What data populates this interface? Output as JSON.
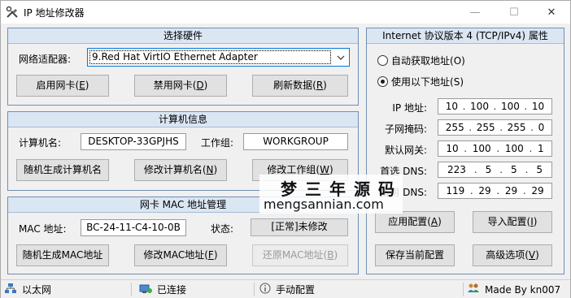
{
  "window": {
    "title": "IP 地址修改器",
    "min_glyph": "—",
    "max_glyph": "☐",
    "close_glyph": "✕"
  },
  "hardware": {
    "header": "选择硬件",
    "adapter_label": "网络适配器:",
    "adapter_value": "9.Red Hat VirtIO Ethernet Adapter",
    "enable_btn": "启用网卡(",
    "enable_key": "E",
    "disable_btn": "禁用网卡(",
    "disable_key": "D",
    "refresh_btn": "刷新数据(",
    "refresh_key": "R"
  },
  "computer": {
    "header": "计算机信息",
    "name_label": "计算机名:",
    "name_value": "DESKTOP-33GPJHS",
    "workgroup_label": "工作组:",
    "workgroup_value": "WORKGROUP",
    "random_name_btn": "随机生成计算机名",
    "modify_name_btn": "修改计算机名(",
    "modify_name_key": "N",
    "modify_group_btn": "修改工作组(",
    "modify_group_key": "W"
  },
  "mac": {
    "header": "网卡 MAC 地址管理",
    "mac_label": "MAC 地址:",
    "mac_value": "BC-24-11-C4-10-0B",
    "status_label": "状态:",
    "status_value": "[正常]未修改",
    "random_mac_btn": "随机生成MAC地址",
    "modify_mac_btn": "修改MAC地址(",
    "modify_mac_key": "F",
    "restore_mac_btn": "还原MAC地址(",
    "restore_mac_key": "B"
  },
  "ipv4": {
    "header": "Internet 协议版本 4 (TCP/IPv4) 属性",
    "auto_label": "自动获取地址(",
    "auto_key": "O",
    "manual_label": "使用以下地址(",
    "manual_key": "S",
    "selected": "manual",
    "ip_label": "IP 地址:",
    "ip": [
      "10",
      "100",
      "100",
      "10"
    ],
    "mask_label": "子网掩码:",
    "mask": [
      "255",
      "255",
      "255",
      "0"
    ],
    "gateway_label": "默认网关:",
    "gateway": [
      "10",
      "100",
      "100",
      "1"
    ],
    "dns1_label": "首选 DNS:",
    "dns1": [
      "223",
      "5",
      "5",
      "5"
    ],
    "dns2_label": "备用 DNS:",
    "dns2": [
      "119",
      "29",
      "29",
      "29"
    ],
    "apply_btn": "应用配置(",
    "apply_key": "A",
    "import_btn": "导入配置(",
    "import_key": "I",
    "save_btn": "保存当前配置",
    "advanced_btn": "高级选项(",
    "advanced_key": "V"
  },
  "statusbar": {
    "network": "以太网",
    "connection": "已连接",
    "mode": "手动配置",
    "author": "Made By kn007"
  },
  "watermark": {
    "cn": "梦三年源码",
    "en": "mengsannian.com"
  }
}
